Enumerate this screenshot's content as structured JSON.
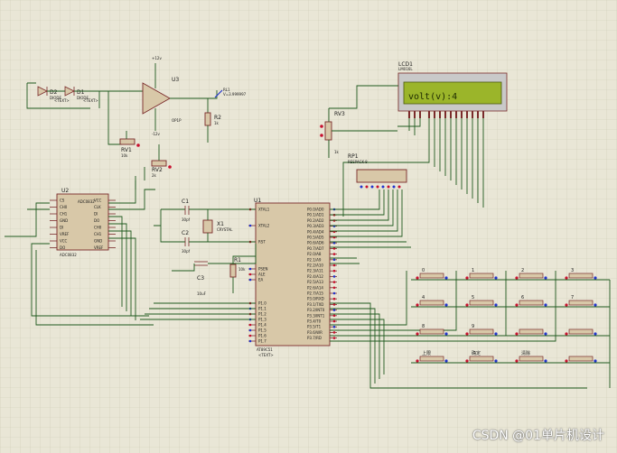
{
  "schematic": {
    "lcd": {
      "ref": "LCD1",
      "part": "LM016L",
      "display": "volt(v):4"
    },
    "mcu": {
      "ref": "U1",
      "part": "AT89C51",
      "left_pins": [
        "XTAL1",
        "XTAL2",
        "RST",
        "PSEN",
        "ALE",
        "EA",
        "P1.0",
        "P1.1",
        "P1.2",
        "P1.3",
        "P1.4",
        "P1.5",
        "P1.6",
        "P1.7"
      ],
      "right_pins": [
        "P0.0/AD0",
        "P0.1/AD1",
        "P0.2/AD2",
        "P0.3/AD3",
        "P0.4/AD4",
        "P0.5/AD5",
        "P0.6/AD6",
        "P0.7/AD7",
        "P2.0/A8",
        "P2.1/A9",
        "P2.2/A10",
        "P2.3/A11",
        "P2.4/A12",
        "P2.5/A13",
        "P2.6/A14",
        "P2.7/A15",
        "P3.0/RXD",
        "P3.1/TXD",
        "P3.2/INT0",
        "P3.3/INT1",
        "P3.4/T0",
        "P3.5/T1",
        "P3.6/WR",
        "P3.7/RD"
      ]
    },
    "adc": {
      "ref": "U2",
      "part": "ADC0832",
      "left_pins": [
        "CS",
        "CH0",
        "CH1",
        "GND",
        "DI",
        "VREF",
        "VCC",
        "DO"
      ],
      "right_pins": [
        "VCC",
        "CLK",
        "DI",
        "DO",
        "CH0",
        "CH1",
        "GND",
        "VREF"
      ]
    },
    "opamp": {
      "ref": "U3",
      "part": "OPAMP",
      "pos_supply": "+12v",
      "neg_supply": "-12v",
      "label": "OP1P"
    },
    "diodes": [
      {
        "ref": "D2",
        "part": "DIODE"
      },
      {
        "ref": "D1",
        "part": "DIODE"
      }
    ],
    "resistors": [
      {
        "ref": "R2",
        "value": "1k"
      },
      {
        "ref": "R1",
        "value": "10k"
      }
    ],
    "rp": {
      "ref": "RP1",
      "part": "RESPACK-8"
    },
    "pots": [
      {
        "ref": "RV1",
        "value": "10k"
      },
      {
        "ref": "RV2",
        "value": "2k"
      },
      {
        "ref": "RV3",
        "value": "1k"
      }
    ],
    "caps": [
      {
        "ref": "C1",
        "value": "30pf"
      },
      {
        "ref": "C2",
        "value": "30pf"
      },
      {
        "ref": "C3",
        "value": "10uF"
      }
    ],
    "crystal": {
      "ref": "X1",
      "part": "CRYSTAL"
    },
    "probe": {
      "ref": "RL1",
      "value": "V=3.999997"
    },
    "keypad": {
      "keys": [
        "0",
        "1",
        "2",
        "3",
        "4",
        "5",
        "6",
        "7",
        "8",
        "9",
        "",
        "",
        "上限",
        "确定",
        "清除",
        ""
      ]
    },
    "text_placeholder": "<TEXT>",
    "watermark": "CSDN @01单片机设计"
  }
}
